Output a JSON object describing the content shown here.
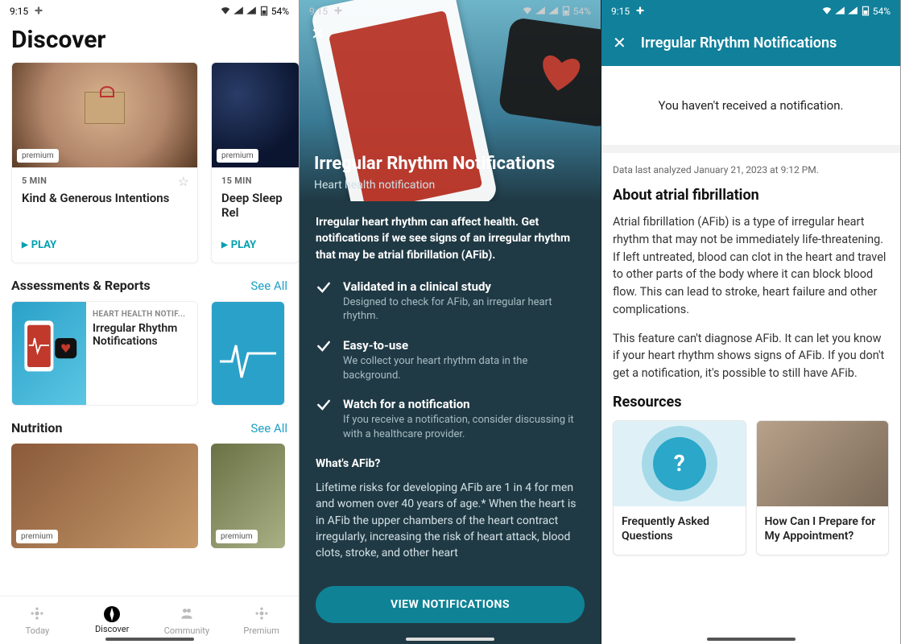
{
  "status": {
    "time": "9:15",
    "battery": "54%"
  },
  "screen1": {
    "title": "Discover",
    "cards": [
      {
        "badge": "premium",
        "duration": "5 MIN",
        "title": "Kind & Generous Intentions",
        "action": "PLAY"
      },
      {
        "badge": "premium",
        "duration": "15 MIN",
        "title": "Deep Sleep Rel",
        "action": "PLAY"
      }
    ],
    "sections": {
      "assess": {
        "title": "Assessments & Reports",
        "see_all": "See All",
        "items": [
          {
            "eyebrow": "HEART HEALTH NOTIF...",
            "title": "Irregular Rhythm Notifications"
          }
        ]
      },
      "nutrition": {
        "title": "Nutrition",
        "see_all": "See All",
        "badge": "premium"
      }
    },
    "tabs": [
      "Today",
      "Discover",
      "Community",
      "Premium"
    ],
    "active_tab": 1
  },
  "screen2": {
    "hero_title": "Irregular Rhythm Notifications",
    "hero_sub": "Heart health notification",
    "lead": "Irregular heart rhythm can affect health. Get notifications if we see signs of an irregular rhythm that may be atrial fibrillation (AFib).",
    "bullets": [
      {
        "title": "Validated in a clinical study",
        "desc": "Designed to check for AFib, an irregular heart rhythm."
      },
      {
        "title": "Easy-to-use",
        "desc": "We collect your heart rhythm data in the background."
      },
      {
        "title": "Watch for a notification",
        "desc": "If you receive a notification, consider discussing it with a healthcare provider."
      }
    ],
    "question": "What's AFib?",
    "paragraph": "Lifetime risks for developing AFib are 1 in 4 for men and women over 40 years of age.* When the heart is in AFib the upper chambers of the heart contract irregularly, increasing the risk of heart attack, blood clots, stroke, and other heart",
    "cta": "VIEW NOTIFICATIONS"
  },
  "screen3": {
    "title": "Irregular Rhythm Notifications",
    "notice": "You haven't received a notification.",
    "meta": "Data last analyzed January 21, 2023 at 9:12 PM.",
    "heading": "About atrial fibrillation",
    "p1": "Atrial fibrillation (AFib) is a type of irregular heart rhythm that may not be immediately life-threatening. If left untreated, blood can clot in the heart and travel to other parts of the body where it can block blood flow. This can lead to stroke, heart failure and other complications.",
    "p2": "This feature can't diagnose AFib. It can let you know if your heart rhythm shows signs of AFib. If you don't get a notification, it's possible to still have AFib.",
    "resources_title": "Resources",
    "resources": [
      {
        "label": "Frequently Asked Questions"
      },
      {
        "label": "How Can I Prepare for My Appointment?"
      }
    ]
  }
}
